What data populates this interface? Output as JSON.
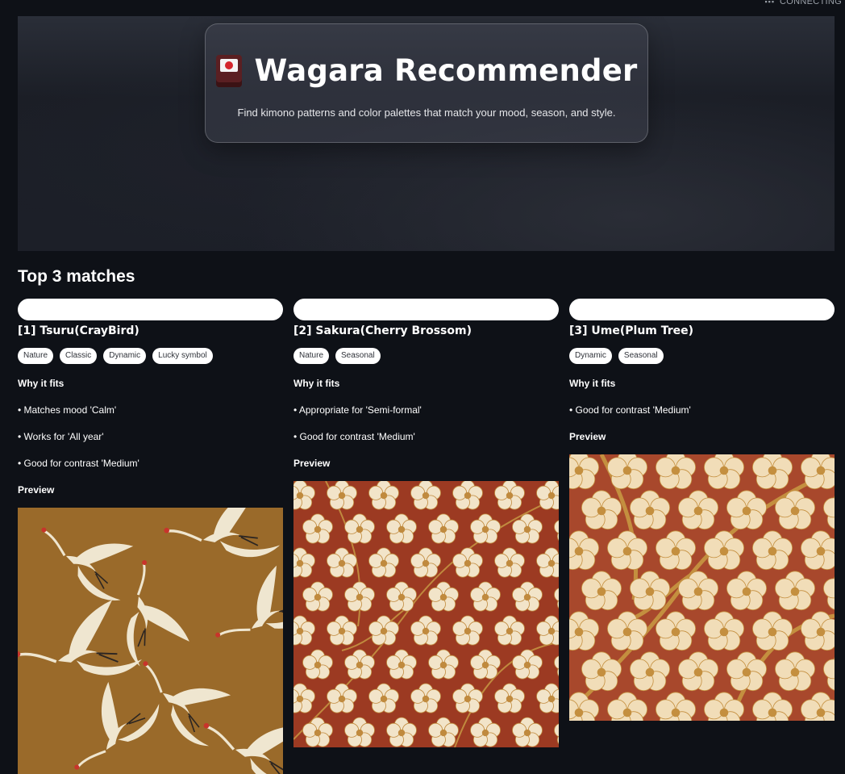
{
  "status": {
    "text": "CONNECTING"
  },
  "hero": {
    "title": "Wagara Recommender",
    "subtitle": "Find kimono patterns and color palettes that match your mood, season, and style.",
    "icon": "flag-icon"
  },
  "results": {
    "heading": "Top 3 matches",
    "why_label": "Why it fits",
    "preview_label": "Preview",
    "cards": [
      {
        "title": "[1] Tsuru(CrayBird)",
        "tags": [
          "Nature",
          "Classic",
          "Dynamic",
          "Lucky symbol"
        ],
        "reasons": [
          "• Matches mood 'Calm'",
          "• Works for 'All year'",
          "• Good for contrast 'Medium'"
        ],
        "preview_colors": {
          "background": "#9a6a2a",
          "motif": "#efe6d0",
          "accent": "#2b2522"
        }
      },
      {
        "title": "[2] Sakura(Cherry Brossom)",
        "tags": [
          "Nature",
          "Seasonal"
        ],
        "reasons": [
          "• Appropriate for 'Semi-formal'",
          "• Good for contrast 'Medium'"
        ],
        "preview_colors": {
          "background": "#9c3a22",
          "motif": "#f2e4c9",
          "accent": "#c08a3e"
        }
      },
      {
        "title": "[3] Ume(Plum Tree)",
        "tags": [
          "Dynamic",
          "Seasonal"
        ],
        "reasons": [
          "• Good for contrast 'Medium'"
        ],
        "preview_colors": {
          "background": "#a8482c",
          "motif": "#f1ddb8",
          "accent": "#c48f3f"
        }
      }
    ]
  }
}
